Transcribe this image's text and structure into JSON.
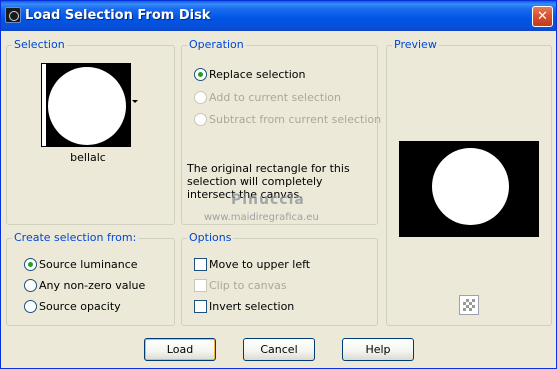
{
  "window": {
    "title": "Load Selection From Disk",
    "close_glyph": "✕"
  },
  "selection": {
    "group_label": "Selection",
    "file_name": "bellalc"
  },
  "operation": {
    "group_label": "Operation",
    "options": [
      {
        "label": "Replace selection",
        "selected": true,
        "enabled": true
      },
      {
        "label": "Add to current selection",
        "selected": false,
        "enabled": false
      },
      {
        "label": "Subtract from current selection",
        "selected": false,
        "enabled": false
      }
    ],
    "note": "The original rectangle for this selection will completely intersect the canvas."
  },
  "watermark": {
    "name": "Pinuccia",
    "url": "www.maidiregrafica.eu"
  },
  "preview": {
    "group_label": "Preview"
  },
  "create_from": {
    "group_label": "Create selection from:",
    "options": [
      {
        "label": "Source luminance",
        "selected": true
      },
      {
        "label": "Any non-zero value",
        "selected": false
      },
      {
        "label": "Source opacity",
        "selected": false
      }
    ]
  },
  "options": {
    "group_label": "Options",
    "items": [
      {
        "label": "Move to upper left",
        "checked": false,
        "enabled": true
      },
      {
        "label": "Clip to canvas",
        "checked": false,
        "enabled": false
      },
      {
        "label": "Invert selection",
        "checked": false,
        "enabled": true
      }
    ]
  },
  "buttons": {
    "load": "Load",
    "cancel": "Cancel",
    "help": "Help"
  },
  "icons": {
    "title": "app-selection-icon",
    "checker": "transparency-checker-icon",
    "dropdown": "chevron-down-icon"
  },
  "colors": {
    "group_label": "#0046d5",
    "title_bar": "#0054e3",
    "radio_dot": "#21a121",
    "dialog_bg": "#ece9d8"
  }
}
